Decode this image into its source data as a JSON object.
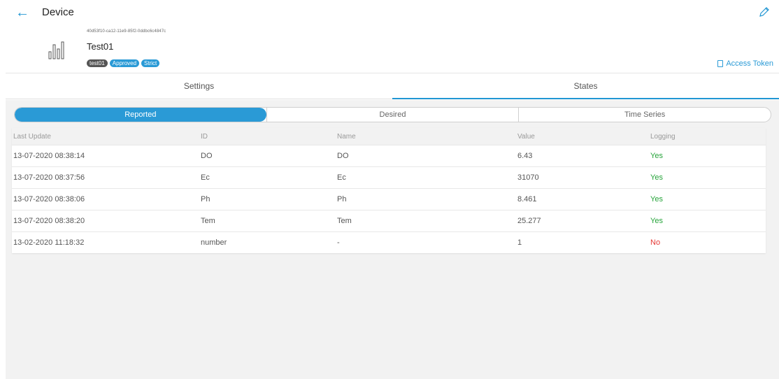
{
  "header": {
    "title": "Device",
    "back_icon": "arrow-left-icon",
    "edit_icon": "pencil-icon",
    "accent": "#2196d3"
  },
  "device": {
    "uuid": "40d53f10-ca12-11e9-85f2-0ddbc6c4847c",
    "name": "Test01",
    "logo_icon": "bar-chart-icon",
    "tags": [
      "test01",
      "Approved",
      "Strict"
    ],
    "access_token_label": "Access Token"
  },
  "tabs": [
    {
      "label": "Settings",
      "active": false
    },
    {
      "label": "States",
      "active": true
    }
  ],
  "segments": [
    {
      "label": "Reported",
      "active": true
    },
    {
      "label": "Desired",
      "active": false
    },
    {
      "label": "Time Series",
      "active": false
    }
  ],
  "table": {
    "columns": [
      "Last Update",
      "ID",
      "Name",
      "Value",
      "Logging"
    ],
    "rows": [
      [
        "13-07-2020 08:38:14",
        "DO",
        "DO",
        "6.43",
        "Yes"
      ],
      [
        "13-07-2020 08:37:56",
        "Ec",
        "Ec",
        "31070",
        "Yes"
      ],
      [
        "13-07-2020 08:38:06",
        "Ph",
        "Ph",
        "8.461",
        "Yes"
      ],
      [
        "13-07-2020 08:38:20",
        "Tem",
        "Tem",
        "25.277",
        "Yes"
      ],
      [
        "13-02-2020 11:18:32",
        "number",
        "-",
        "1",
        "No"
      ]
    ]
  },
  "colors": {
    "yes": "#27a43b",
    "no": "#e53935",
    "tag_blue": "#2a9ad6",
    "tag_gray": "#555555"
  }
}
